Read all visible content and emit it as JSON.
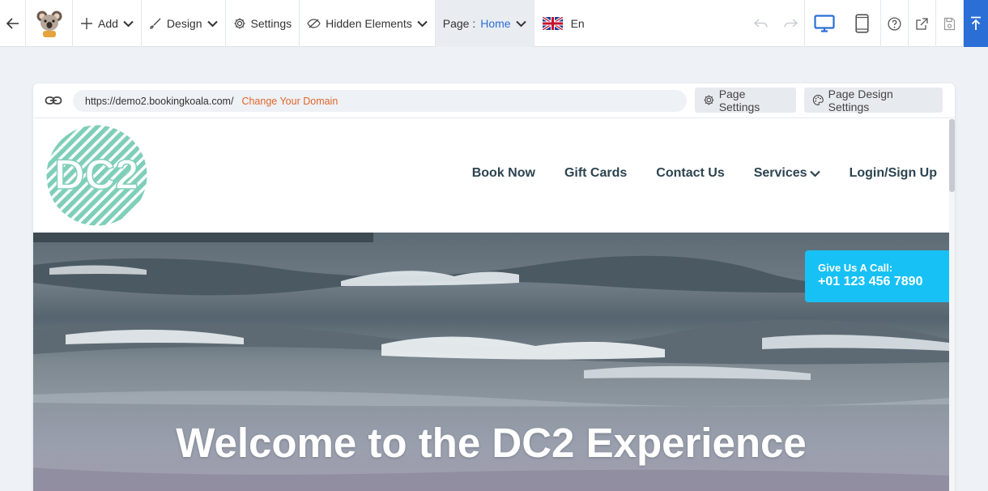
{
  "toolbar": {
    "add_label": "Add",
    "design_label": "Design",
    "settings_label": "Settings",
    "hidden_elements_label": "Hidden Elements",
    "page_prefix": "Page :",
    "page_value": "Home",
    "language_code": "En"
  },
  "urlbar": {
    "url": "https://demo2.bookingkoala.com/",
    "change_domain_label": "Change Your Domain",
    "page_settings_label": "Page Settings",
    "page_design_settings_label": "Page Design Settings"
  },
  "site": {
    "logo_text": "DC2",
    "nav": {
      "book_now": "Book Now",
      "gift_cards": "Gift Cards",
      "contact_us": "Contact Us",
      "services": "Services",
      "login": "Login/Sign Up"
    },
    "call_box": {
      "line1": "Give Us A Call:",
      "line2": "+01 123 456 7890"
    },
    "hero_title": "Welcome to the DC2 Experience"
  },
  "colors": {
    "accent": "#2b6fd6",
    "change_domain": "#e0672a",
    "call_box": "#17c1f5",
    "nav_text": "#2c4450",
    "logo": "#7fcfb8"
  },
  "icons": [
    "back-arrow-icon",
    "koala-logo-icon",
    "plus-icon",
    "brush-icon",
    "gear-icon",
    "eye-slash-icon",
    "chevron-down-icon",
    "uk-flag-icon",
    "undo-icon",
    "redo-icon",
    "desktop-icon",
    "tablet-icon",
    "help-icon",
    "external-link-icon",
    "save-icon",
    "publish-icon",
    "link-icon",
    "palette-icon"
  ]
}
